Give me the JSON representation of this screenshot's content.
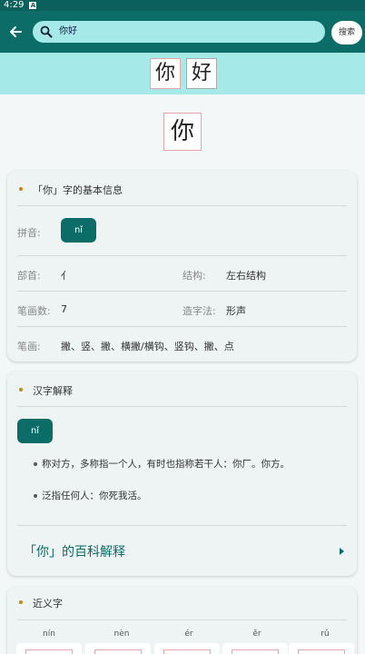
{
  "status_bar": {
    "time": "4:29",
    "notification_icon": "A"
  },
  "app_bar": {
    "search_value": "你好",
    "search_button": "搜索"
  },
  "banner_chars": [
    "你",
    "好"
  ],
  "selected_char": "你",
  "basic_info": {
    "title": "「你」字的基本信息",
    "pinyin_label": "拼音:",
    "pinyin": "nǐ",
    "radical_label": "部首:",
    "radical": "亻",
    "structure_label": "结构:",
    "structure": "左右结构",
    "stroke_count_label": "笔画数:",
    "stroke_count": "7",
    "formation_label": "造字法:",
    "formation": "形声",
    "strokes_label": "笔画:",
    "strokes": "撇、竖、撇、横撇/横钩、竖钩、撇、点"
  },
  "explanation": {
    "title": "汉字解释",
    "pinyin": "nǐ",
    "definitions": [
      "称对方，多称指一个人，有时也指称若干人：你厂。你方。",
      "泛指任何人：你死我活。"
    ],
    "baike_link": "「你」的百科解释"
  },
  "synonyms": {
    "title": "近义字",
    "pinyins": [
      "nín",
      "nèn",
      "ér",
      "ěr",
      "rǔ"
    ]
  },
  "colors": {
    "primary": "#0b6c68",
    "banner": "#a6e9e9",
    "accent_dot": "#c08a17"
  }
}
